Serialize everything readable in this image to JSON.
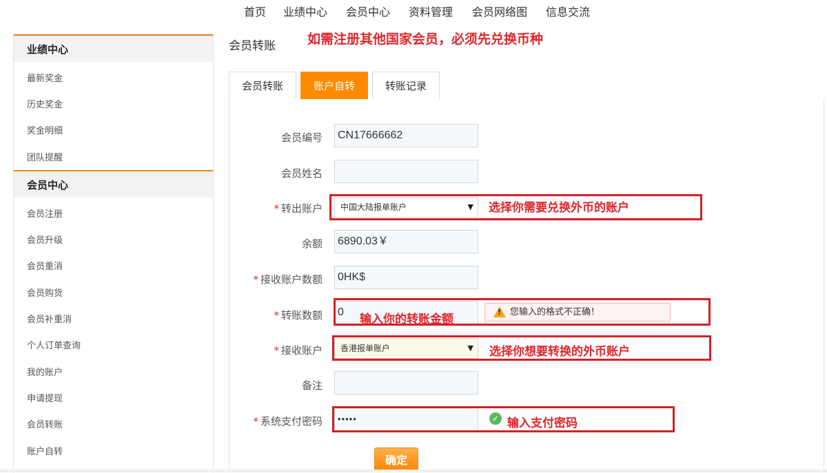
{
  "nav": {
    "items": [
      "首页",
      "业绩中心",
      "会员中心",
      "资料管理",
      "会员网络图",
      "信息交流"
    ]
  },
  "sidebar": {
    "groups": [
      {
        "title": "业绩中心",
        "items": [
          "最新奖金",
          "历史奖金",
          "奖金明细",
          "团队提醒"
        ]
      },
      {
        "title": "会员中心",
        "items": [
          "会员注册",
          "会员升级",
          "会员重消",
          "会员购货",
          "会员补重消",
          "个人订单查询",
          "我的账户",
          "申请提现",
          "会员转账",
          "账户自转"
        ]
      }
    ]
  },
  "main": {
    "title": "会员转账",
    "notice": "如需注册其他国家会员，必须先兑换币种",
    "tabs": [
      {
        "label": "会员转账",
        "active": false
      },
      {
        "label": "账户自转",
        "active": true
      },
      {
        "label": "转账记录",
        "active": false
      }
    ]
  },
  "form": {
    "member_id": {
      "label": "会员编号",
      "value": "CN17666662"
    },
    "member_name": {
      "label": "会员姓名",
      "value": ""
    },
    "from_account": {
      "label": "转出账户",
      "required": "*",
      "value": "中国大陆报单账户"
    },
    "balance": {
      "label": "余额",
      "value": "6890.03￥"
    },
    "receive_amount": {
      "label": "接收账户数额",
      "required": "*",
      "value": "0HK$"
    },
    "transfer_amount": {
      "label": "转账数额",
      "required": "*",
      "value": "0"
    },
    "to_account": {
      "label": "接收账户",
      "required": "*",
      "value": "香港报单账户"
    },
    "remark": {
      "label": "备注",
      "value": ""
    },
    "pay_password": {
      "label": "系统支付密码",
      "required": "*",
      "value": "•••••"
    },
    "error_tip": "您输入的格式不正确！",
    "submit_label": "确定"
  },
  "annotations": {
    "from_account": "选择你需要兑换外币的账户",
    "transfer_amount": "输入你的转账金额",
    "to_account": "选择你想要转换的外币账户",
    "pay_password": "输入支付密码"
  },
  "colors": {
    "accent": "#ff8a00",
    "annotation": "#e0262b",
    "sidebar_border": "#e8822a"
  },
  "icons": [
    "warning-icon",
    "check-circle-icon",
    "caret-down-icon"
  ]
}
